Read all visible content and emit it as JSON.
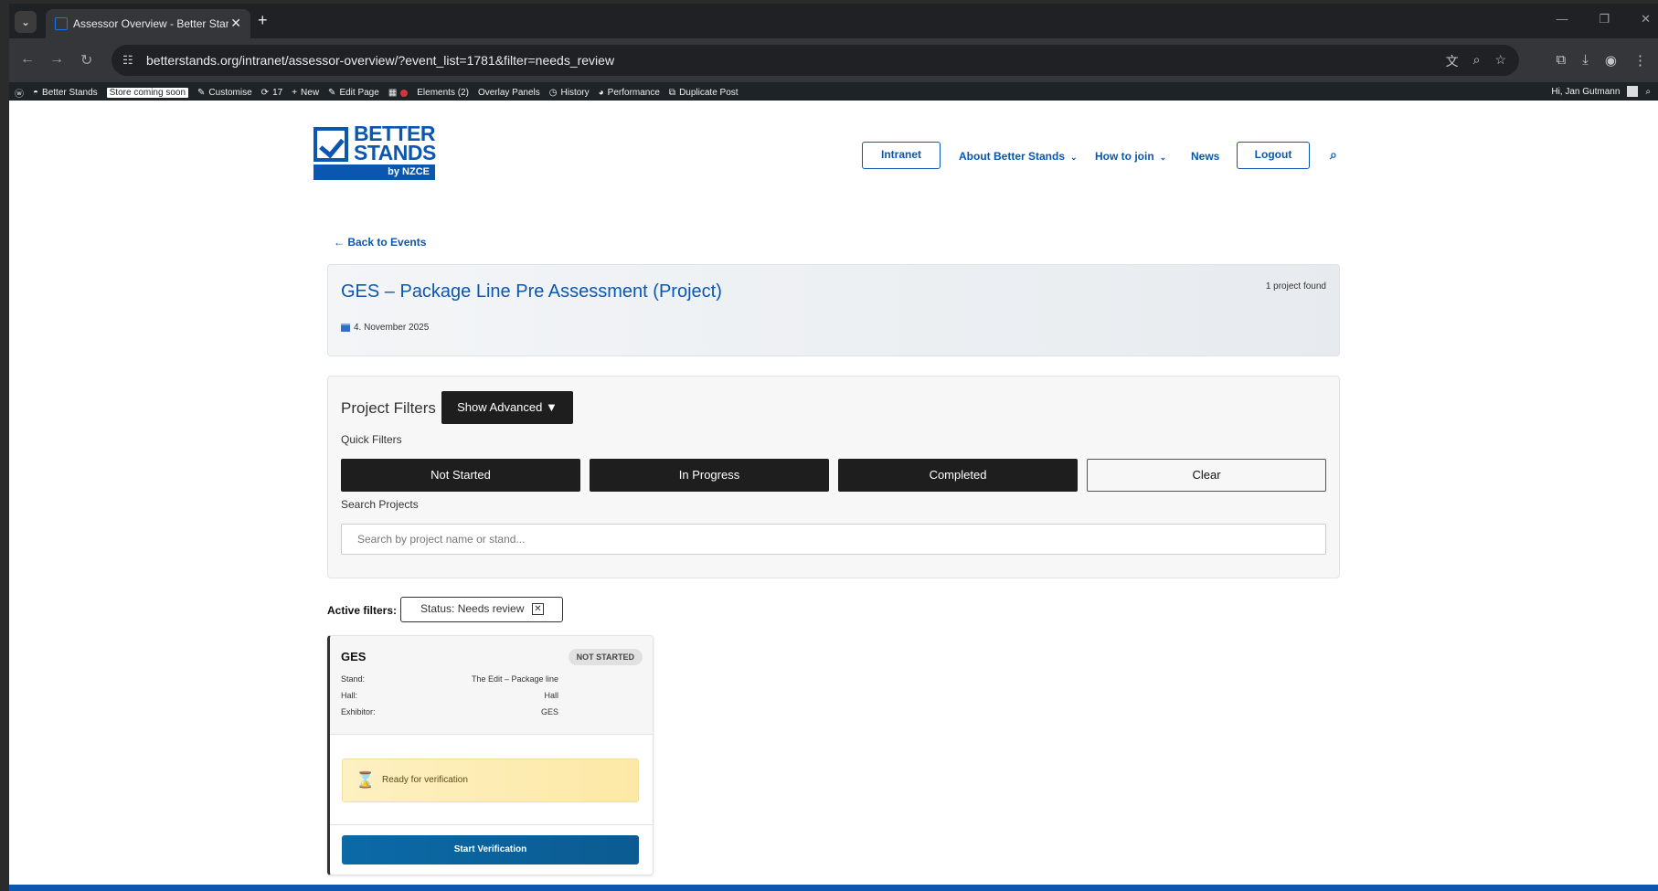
{
  "browser": {
    "tab_title": "Assessor Overview - Better Stan",
    "url": "betterstands.org/intranet/assessor-overview/?event_list=1781&filter=needs_review"
  },
  "admin_bar": {
    "site_name": "Better Stands",
    "store_badge": "Store coming soon",
    "customise": "Customise",
    "updates_count": "17",
    "new": "New",
    "edit_page": "Edit Page",
    "elements": "Elements (2)",
    "overlay_panels": "Overlay Panels",
    "history": "History",
    "performance": "Performance",
    "duplicate_post": "Duplicate Post",
    "greeting": "Hi, Jan Gutmann"
  },
  "logo": {
    "line1": "BETTER",
    "line2": "STANDS",
    "byline": "by NZCE"
  },
  "nav": {
    "intranet": "Intranet",
    "about": "About Better Stands",
    "how_to_join": "How to join",
    "news": "News",
    "logout": "Logout"
  },
  "back_link": "← Back to Events",
  "event": {
    "title": "GES – Package Line Pre Assessment (Project)",
    "count": "1 project found",
    "date": "4. November 2025"
  },
  "filters": {
    "title": "Project Filters",
    "show_advanced": "Show Advanced ▼",
    "quick_label": "Quick Filters",
    "quick": {
      "not_started": "Not Started",
      "in_progress": "In Progress",
      "completed": "Completed",
      "clear": "Clear"
    },
    "search_label": "Search Projects",
    "search_placeholder": "Search by project name or stand..."
  },
  "active_filters": {
    "label": "Active filters:",
    "chip": "Status: Needs review"
  },
  "project": {
    "name": "GES",
    "status": "NOT STARTED",
    "stand_label": "Stand:",
    "stand_value": "The Edit – Package line",
    "hall_label": "Hall:",
    "hall_value": "Hall",
    "exhibitor_label": "Exhibitor:",
    "exhibitor_value": "GES",
    "notice": "Ready for verification",
    "action": "Start Verification"
  },
  "colors": {
    "brand_blue": "#0b57b0",
    "dark_button": "#1e1e1e",
    "notice_yellow": "#fdf0c2",
    "action_blue": "#0b6aa7"
  }
}
